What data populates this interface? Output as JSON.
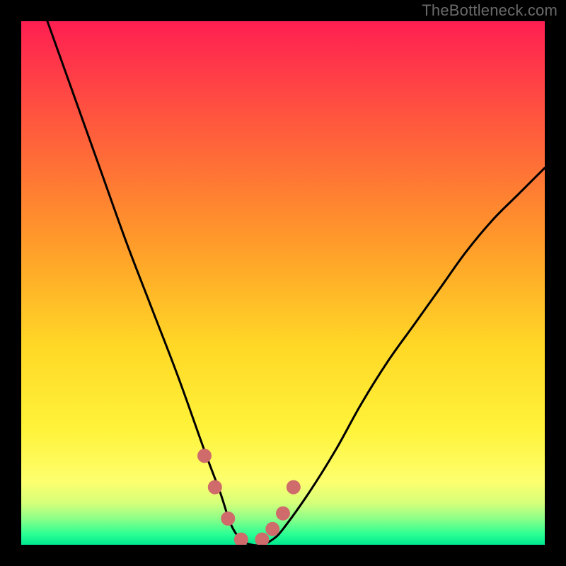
{
  "watermark": "TheBottleneck.com",
  "chart_data": {
    "type": "line",
    "title": "",
    "xlabel": "",
    "ylabel": "",
    "x_range": [
      0,
      100
    ],
    "y_range": [
      0,
      100
    ],
    "x": [
      5,
      10,
      15,
      20,
      25,
      30,
      35,
      38,
      40,
      42,
      44,
      46,
      48,
      50,
      55,
      60,
      65,
      70,
      75,
      80,
      85,
      90,
      95,
      100
    ],
    "values": [
      100,
      86,
      72,
      58,
      45,
      32,
      18,
      10,
      4,
      1,
      0,
      0,
      1,
      3,
      10,
      18,
      27,
      35,
      42,
      49,
      56,
      62,
      67,
      72
    ],
    "gradient_stops": [
      {
        "offset": 0.0,
        "color": "#ff1f52"
      },
      {
        "offset": 0.2,
        "color": "#ff5a3d"
      },
      {
        "offset": 0.42,
        "color": "#ff9a2a"
      },
      {
        "offset": 0.62,
        "color": "#ffd826"
      },
      {
        "offset": 0.78,
        "color": "#fff33a"
      },
      {
        "offset": 0.88,
        "color": "#fdff6e"
      },
      {
        "offset": 0.92,
        "color": "#d6ff7a"
      },
      {
        "offset": 0.95,
        "color": "#8cff88"
      },
      {
        "offset": 0.98,
        "color": "#2bff94"
      },
      {
        "offset": 1.0,
        "color": "#00e890"
      }
    ],
    "marker_color": "#cf6b6b",
    "marker_radius": 10,
    "curve_color": "#000000",
    "curve_width": 3,
    "marker_points_x": [
      35,
      37,
      39.5,
      42,
      46,
      48,
      50,
      52
    ],
    "marker_points_y": [
      17,
      11,
      5,
      1,
      1,
      3,
      6,
      11
    ]
  }
}
